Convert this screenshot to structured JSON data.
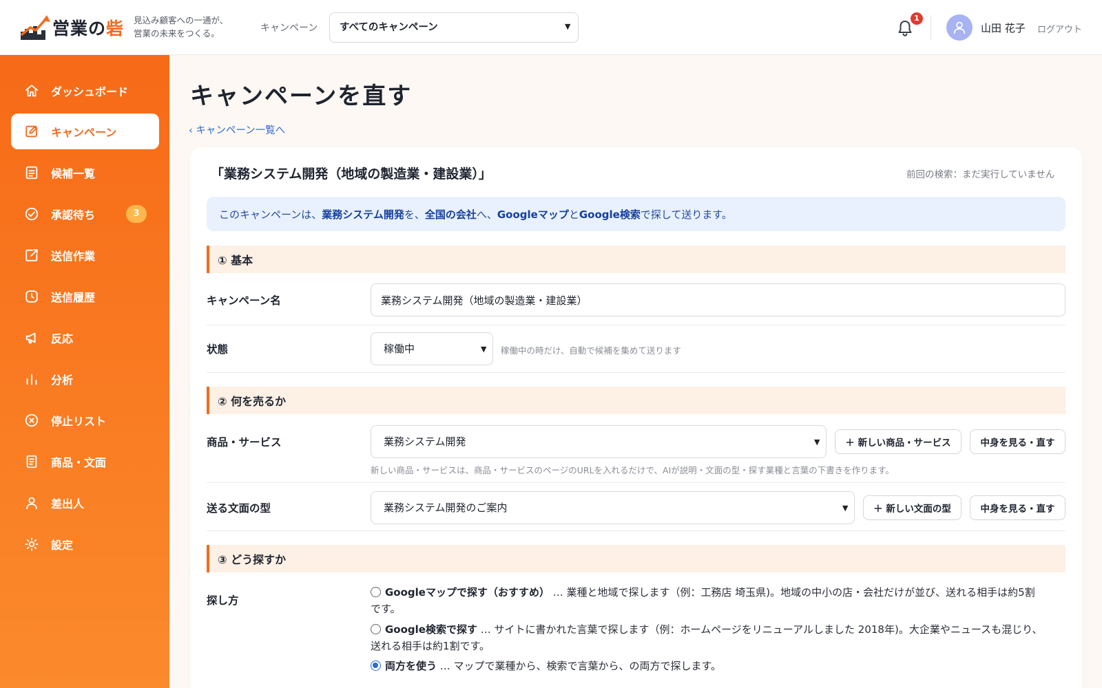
{
  "header": {
    "logo": {
      "text_main": "営業の",
      "text_accent": "砦"
    },
    "tagline_line1": "見込み顧客への一通が、",
    "tagline_line2": "営業の未来をつくる。",
    "campaign_label": "キャンペーン",
    "campaign_select_value": "すべてのキャンペーン",
    "notification_count": "1",
    "user_name": "山田 花子",
    "logout": "ログアウト"
  },
  "sidebar": {
    "items": [
      {
        "label": "ダッシュボード",
        "icon": "home-icon"
      },
      {
        "label": "キャンペーン",
        "icon": "edit-icon",
        "active": true
      },
      {
        "label": "候補一覧",
        "icon": "list-icon"
      },
      {
        "label": "承認待ち",
        "icon": "check-circle-icon",
        "badge": "3"
      },
      {
        "label": "送信作業",
        "icon": "external-edit-icon"
      },
      {
        "label": "送信履歴",
        "icon": "clock-icon"
      },
      {
        "label": "反応",
        "icon": "megaphone-icon"
      },
      {
        "label": "分析",
        "icon": "bar-chart-icon"
      },
      {
        "label": "停止リスト",
        "icon": "x-circle-icon"
      },
      {
        "label": "商品・文面",
        "icon": "document-icon"
      },
      {
        "label": "差出人",
        "icon": "user-icon"
      },
      {
        "label": "設定",
        "icon": "gear-icon"
      }
    ]
  },
  "main": {
    "page_title": "キャンペーンを直す",
    "back_link": "‹ キャンペーン一覧へ",
    "card_title": "「業務システム開発（地域の製造業・建設業）」",
    "last_search": "前回の検索：まだ実行していません",
    "info_banner": {
      "p1": "このキャンペーンは、",
      "b1": "業務システム開発",
      "p2": "を、",
      "b2": "全国の会社",
      "p3": "へ、",
      "b3": "Googleマップ",
      "p4": "と ",
      "b4": "Google検索",
      "p5": "で探して送ります。"
    },
    "section1": {
      "title": "① 基本",
      "name_label": "キャンペーン名",
      "name_value": "業務システム開発（地域の製造業・建設業）",
      "status_label": "状態",
      "status_value": "稼働中",
      "status_hint": "稼働中の時だけ、自動で候補を集めて送ります"
    },
    "section2": {
      "title": "② 何を売るか",
      "product_label": "商品・サービス",
      "product_value": "業務システム開発",
      "new_product_button": "＋ 新しい商品・サービス",
      "view_product_button": "中身を見る・直す",
      "product_hint": "新しい商品・サービスは、商品・サービスのページのURLを入れるだけで、AIが説明・文面の型・探す業種と言葉の下書きを作ります。",
      "template_label": "送る文面の型",
      "template_value": "業務システム開発のご案内",
      "new_template_button": "＋ 新しい文面の型",
      "view_template_button": "中身を見る・直す"
    },
    "section3": {
      "title": "③ どう探すか",
      "method_label": "探し方",
      "options": [
        {
          "title": "Googleマップで探す（おすすめ）",
          "line1": " … 業種と地域で探します（例：工務店 埼玉県)。地域の中小の店・会社だけが並び、送れる相手は約5割",
          "line2": "です。",
          "checked": false
        },
        {
          "title": "Google検索で探す",
          "line1": " … サイトに書かれた言葉で探します（例：ホームページをリニューアルしました 2018年)。大企業やニュースも混じり、",
          "line2": "送れる相手は約1割です。",
          "checked": false
        },
        {
          "title": "両方を使う",
          "line1": " … マップで業種から、検索で言葉から、の両方で探します。",
          "line2": "",
          "checked": true
        }
      ]
    }
  }
}
